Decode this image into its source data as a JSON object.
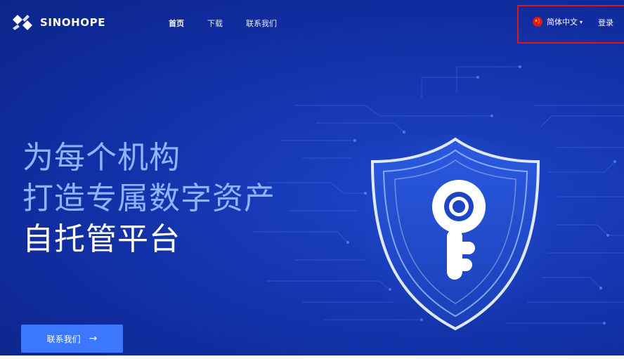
{
  "brand": {
    "name": "SINOHOPE"
  },
  "nav": {
    "items": [
      {
        "label": "首页",
        "active": true
      },
      {
        "label": "下载",
        "active": false
      },
      {
        "label": "联系我们",
        "active": false
      }
    ]
  },
  "header_right": {
    "language": "简体中文",
    "language_caret": "▾",
    "flag_icon": "china-flag-icon",
    "login": "登录"
  },
  "hero": {
    "line1": "为每个机构",
    "line2": "打造专属数字资产",
    "line3": "自托管平台",
    "cta_label": "联系我们",
    "cta_arrow": "→"
  },
  "colors": {
    "background": "#1536b0",
    "accent_button": "#3c78ff",
    "highlight_box": "#e0161b",
    "headline_soft": "#8fb3ff"
  }
}
